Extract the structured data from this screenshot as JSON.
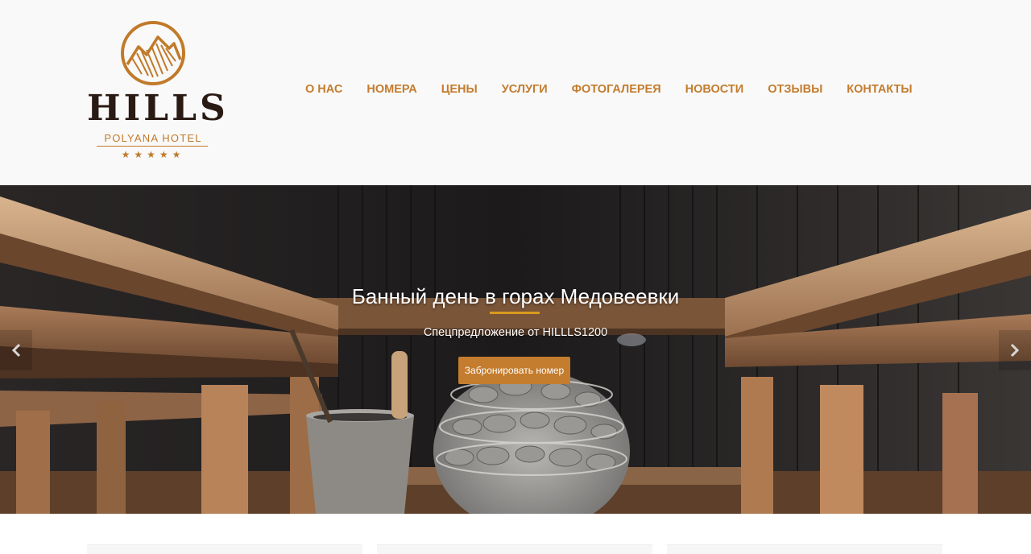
{
  "brand": {
    "name": "HILLS",
    "subtitle": "POLYANA HOTEL",
    "stars": "★★★★★",
    "accent": "#c47c2e",
    "dark": "#2a1a14"
  },
  "nav": {
    "items": [
      {
        "label": "О НАС"
      },
      {
        "label": "НОМЕРА"
      },
      {
        "label": "ЦЕНЫ"
      },
      {
        "label": "УСЛУГИ"
      },
      {
        "label": "ФОТОГАЛЕРЕЯ"
      },
      {
        "label": "НОВОСТИ"
      },
      {
        "label": "ОТЗЫВЫ"
      },
      {
        "label": "КОНТАКТЫ"
      }
    ]
  },
  "hero": {
    "title": "Банный день в горах Медовеевки",
    "subtitle": "Спецпредложение от HILLLS1200",
    "button_label": "Забронировать номер",
    "prev_icon": "chevron-left-icon",
    "next_icon": "chevron-right-icon"
  }
}
